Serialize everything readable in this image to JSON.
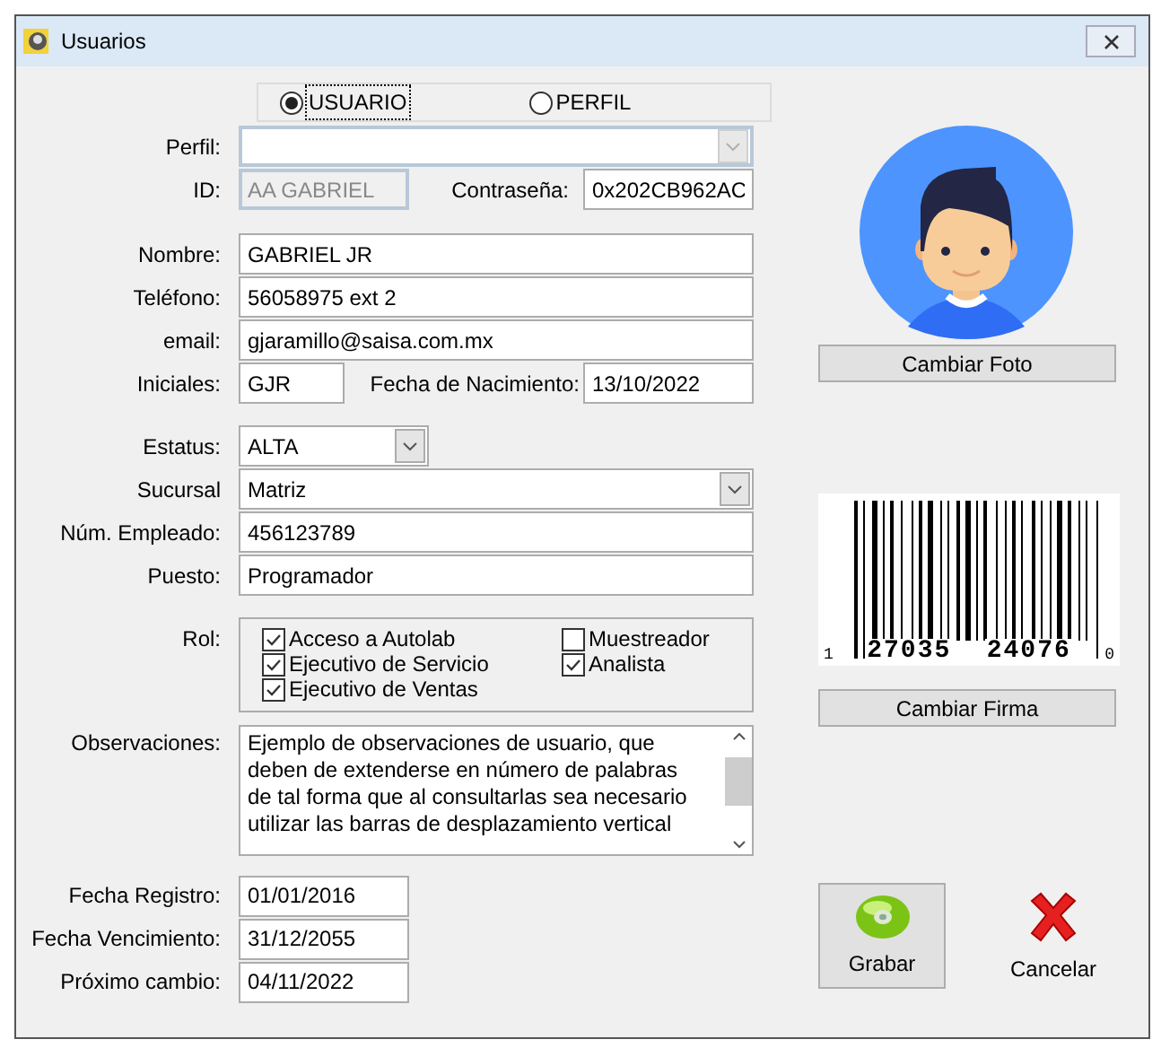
{
  "window": {
    "title": "Usuarios"
  },
  "mode_options": [
    {
      "label": "USUARIO",
      "selected": true
    },
    {
      "label": "PERFIL",
      "selected": false
    }
  ],
  "perfil": {
    "label": "Perfil:",
    "disabled": true
  },
  "id": {
    "label": "ID:",
    "value": "AA GABRIEL",
    "disabled": true
  },
  "password": {
    "label": "Contraseña:",
    "value": "0x202CB962AC"
  },
  "contact_fields": [
    {
      "label": "Nombre:",
      "value": "GABRIEL JR"
    },
    {
      "label": "Teléfono:",
      "value": "56058975 ext 2"
    },
    {
      "label": "email:",
      "value": "gjaramillo@saisa.com.mx"
    }
  ],
  "initials": {
    "label": "Iniciales:",
    "value": "GJR"
  },
  "birth_date": {
    "label": "Fecha de Nacimiento:",
    "value": "13/10/2022"
  },
  "estatus": {
    "label": "Estatus:",
    "value": "ALTA"
  },
  "sucursal": {
    "label": "Sucursal",
    "value": "Matriz"
  },
  "employee_fields": [
    {
      "label": "Núm. Empleado:",
      "value": "456123789"
    },
    {
      "label": "Puesto:",
      "value": "Programador"
    }
  ],
  "roles": {
    "label": "Rol:",
    "items": [
      {
        "label": "Acceso a Autolab",
        "checked": true
      },
      {
        "label": "Muestreador",
        "checked": false
      },
      {
        "label": "Ejecutivo de Servicio",
        "checked": true
      },
      {
        "label": "Analista",
        "checked": true
      },
      {
        "label": "Ejecutivo de Ventas",
        "checked": true
      }
    ]
  },
  "observations": {
    "label": "Observaciones:",
    "value": "Ejemplo de observaciones de usuario, que deben de extenderse en número de palabras de tal forma que al consultarlas sea necesario utilizar las barras de desplazamiento vertical"
  },
  "dates": [
    {
      "label": "Fecha Registro:",
      "value": "01/01/2016"
    },
    {
      "label": "Fecha Vencimiento:",
      "value": "31/12/2055"
    },
    {
      "label": "Próximo cambio:",
      "value": "04/11/2022"
    }
  ],
  "photo_button": "Cambiar Foto",
  "barcode_digits": [
    "1",
    "27035",
    "24076",
    "0"
  ],
  "signature_button": "Cambiar Firma",
  "buttons": [
    {
      "kind": "save",
      "label": "Grabar"
    },
    {
      "kind": "cancel",
      "label": "Cancelar"
    }
  ]
}
